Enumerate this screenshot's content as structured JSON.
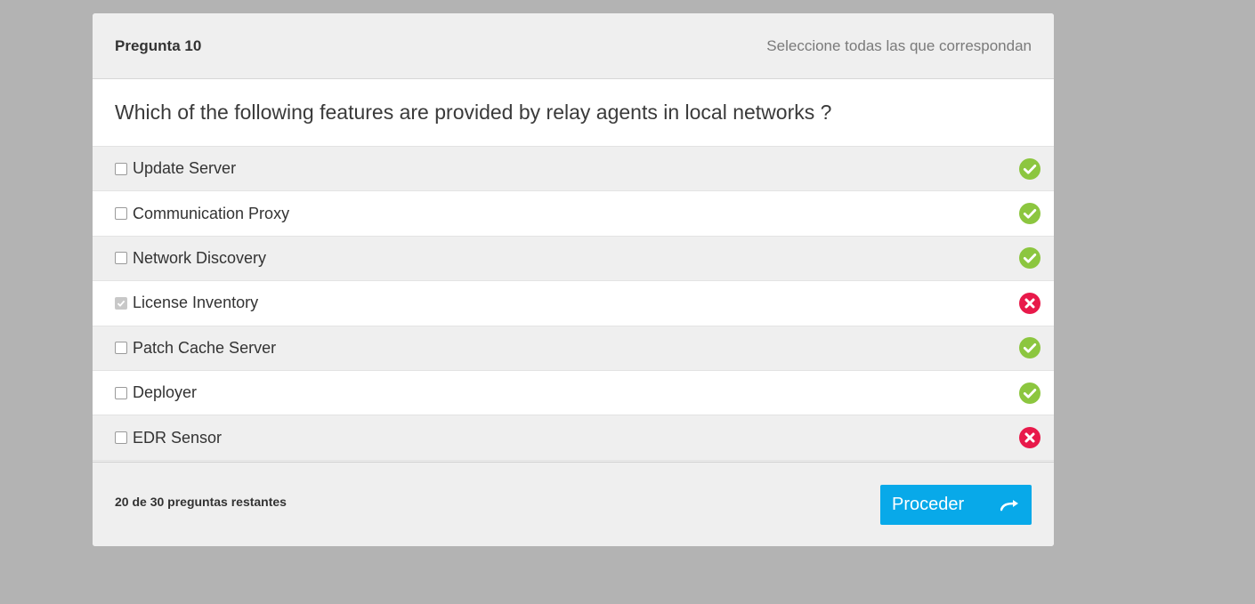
{
  "header": {
    "question_number": "Pregunta 10",
    "instruction": "Seleccione todas las que correspondan"
  },
  "question": {
    "text": "Which of the following features are provided by relay agents in local networks ?"
  },
  "options": [
    {
      "label": "Update Server",
      "checked": false,
      "status": "correct"
    },
    {
      "label": "Communication Proxy",
      "checked": false,
      "status": "correct"
    },
    {
      "label": "Network Discovery",
      "checked": false,
      "status": "correct"
    },
    {
      "label": "License Inventory",
      "checked": true,
      "status": "incorrect"
    },
    {
      "label": "Patch Cache Server",
      "checked": false,
      "status": "correct"
    },
    {
      "label": "Deployer",
      "checked": false,
      "status": "correct"
    },
    {
      "label": "EDR Sensor",
      "checked": false,
      "status": "incorrect"
    }
  ],
  "footer": {
    "remaining": "20 de 30 preguntas restantes",
    "proceed_label": "Proceder"
  },
  "colors": {
    "correct": "#8cc63f",
    "incorrect": "#e8194a",
    "button": "#08a9e9"
  },
  "icons": {
    "correct": "check-circle-icon",
    "incorrect": "x-circle-icon",
    "proceed": "arrow-right-icon"
  }
}
